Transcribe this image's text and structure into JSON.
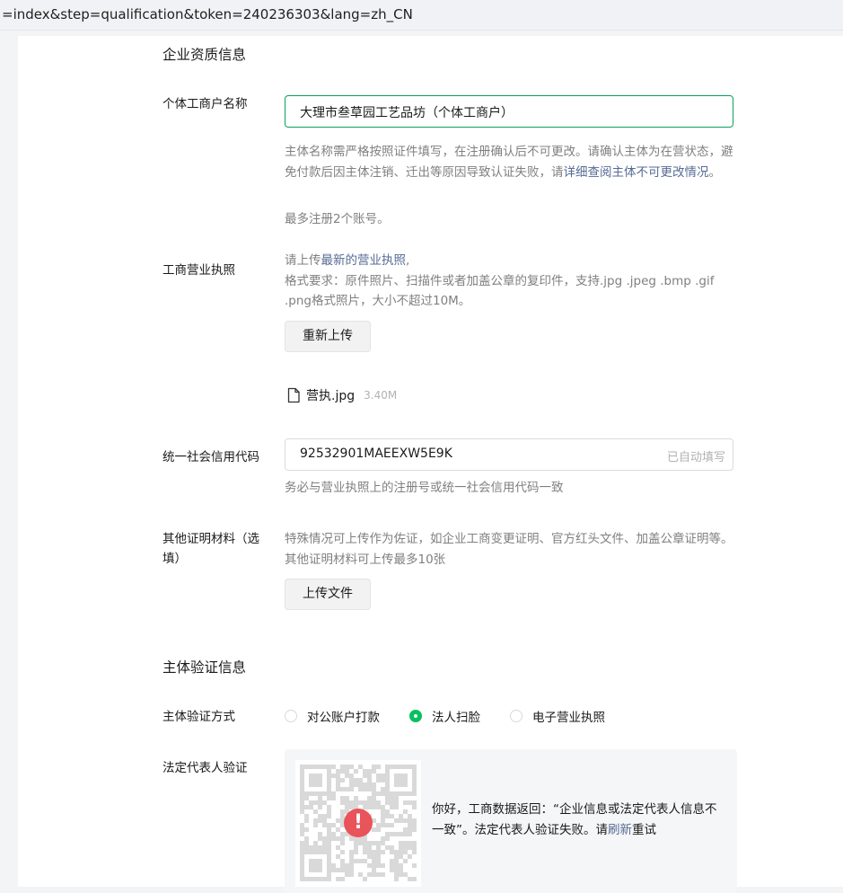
{
  "browser": {
    "url": "=index&step=qualification&token=240236303&lang=zh_CN"
  },
  "sections": {
    "qualification_title": "企业资质信息",
    "verification_title": "主体验证信息"
  },
  "business_name": {
    "label": "个体工商户名称",
    "value": "大理市叁草园工艺品坊（个体工商户）",
    "hint_before_link": "主体名称需严格按照证件填写，在注册确认后不可更改。请确认主体为在营状态，避免付款后因主体注销、迁出等原因导致认证失败，请",
    "hint_link": "详细查阅主体不可更改情况",
    "hint_after_link": "。",
    "limit_note": "最多注册2个账号。"
  },
  "license": {
    "label": "工商营业执照",
    "hint_line1_prefix": "请上传",
    "hint_line1_link": "最新的营业执照",
    "hint_line1_suffix": ",",
    "hint_line2": "格式要求：原件照片、扫描件或者加盖公章的复印件，支持.jpg .jpeg .bmp .gif .png格式照片，大小不超过10M。",
    "reupload_label": "重新上传",
    "file_icon": "file-icon",
    "file_name": "营执.jpg",
    "file_size": "3.40M"
  },
  "credit_code": {
    "label": "统一社会信用代码",
    "value": "92532901MAEEXW5E9K",
    "suffix": "已自动填写",
    "hint": "务必与营业执照上的注册号或统一社会信用代码一致"
  },
  "other_docs": {
    "label": "其他证明材料（选填）",
    "hint": "特殊情况可上传作为佐证，如企业工商变更证明、官方红头文件、加盖公章证明等。其他证明材料可上传最多10张",
    "upload_label": "上传文件"
  },
  "verify_method": {
    "label": "主体验证方式",
    "options": [
      {
        "label": "对公账户打款",
        "checked": false
      },
      {
        "label": "法人扫脸",
        "checked": true
      },
      {
        "label": "电子营业执照",
        "checked": false
      }
    ]
  },
  "legal_rep": {
    "label": "法定代表人验证",
    "alert_icon": "alert-icon",
    "alert_glyph": "!",
    "message_before_link": "你好，工商数据返回：“企业信息或法定代表人信息不一致”。法定代表人验证失败。请",
    "message_link": "刷新",
    "message_after_link": "重试"
  },
  "colors": {
    "accent_green": "#07c160",
    "focus_border": "#07a35a",
    "link": "#576b95",
    "alert_red": "#e9535a"
  }
}
